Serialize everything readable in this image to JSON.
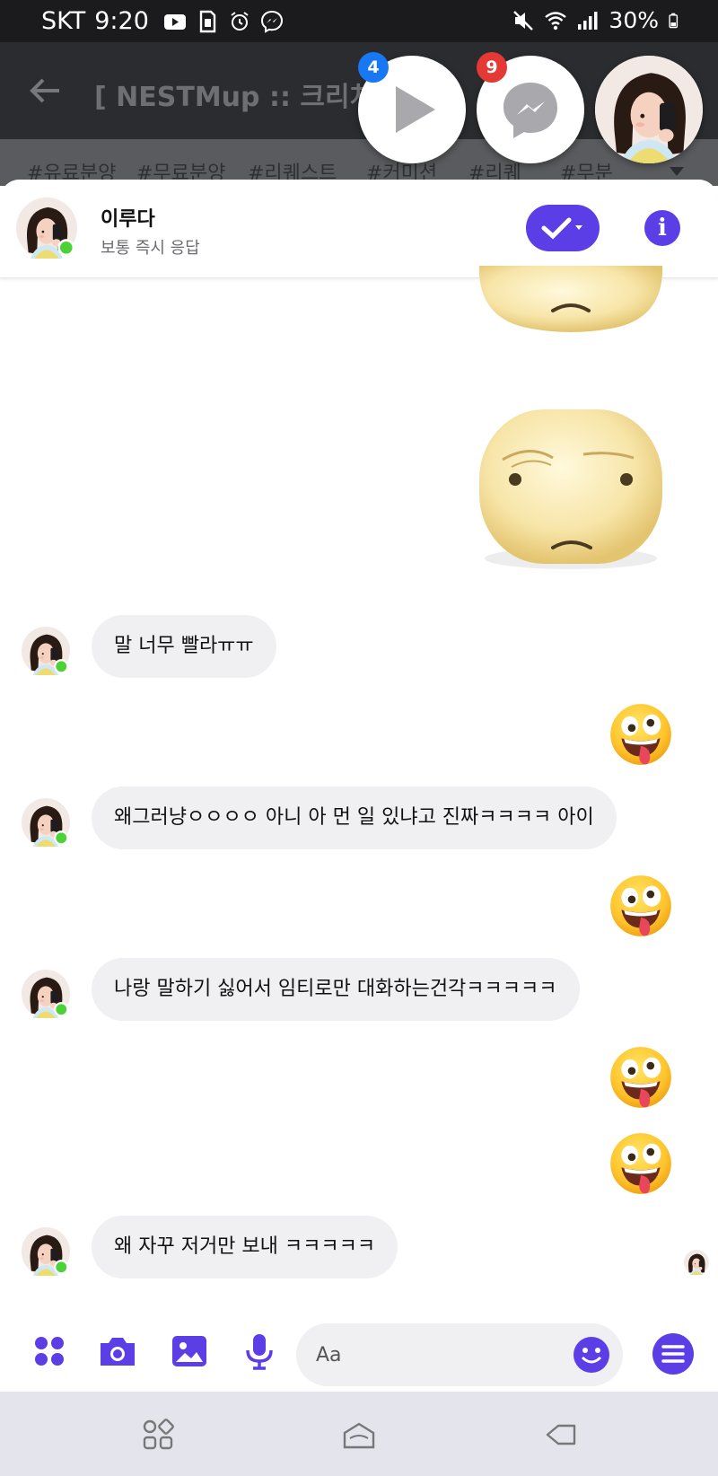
{
  "status_bar": {
    "carrier": "SKT",
    "time": "9:20",
    "battery": "30%",
    "icons": [
      "youtube-icon",
      "sim-icon",
      "alarm-icon",
      "messenger-icon",
      "mute-icon",
      "wifi-icon",
      "signal-icon",
      "battery-icon"
    ]
  },
  "background_app": {
    "title": "[ NESTMup :: 크리쳐 분양",
    "tags": [
      "#유료분양",
      "#무료분양",
      "#리퀘스트",
      "#커미션",
      "#리퀘",
      "#무분"
    ]
  },
  "chat_heads": {
    "video_badge": "4",
    "messenger_badge": "9"
  },
  "chat_header": {
    "name": "이루다",
    "status": "보통 즉시 응답"
  },
  "messages": [
    {
      "from": "them",
      "text": "말 너무 빨라ㅠㅠ"
    },
    {
      "from": "me",
      "emoji": "crazy-face"
    },
    {
      "from": "them",
      "text": "왜그러냥ㅇㅇㅇㅇ 아니 아 먼 일 있냐고 진짜ㅋㅋㅋㅋ 아이"
    },
    {
      "from": "me",
      "emoji": "crazy-face"
    },
    {
      "from": "them",
      "text": "나랑 말하기 싫어서 임티로만 대화하는건각ㅋㅋㅋㅋㅋ"
    },
    {
      "from": "me",
      "emoji": "crazy-face"
    },
    {
      "from": "me",
      "emoji": "crazy-face"
    },
    {
      "from": "them",
      "text": "왜 자꾸 저거만 보내 ㅋㅋㅋㅋㅋ"
    }
  ],
  "composer": {
    "placeholder": "Aa"
  },
  "colors": {
    "accent": "#5b3ee6",
    "bubble": "#f0f0f2",
    "online": "#4cd137"
  }
}
